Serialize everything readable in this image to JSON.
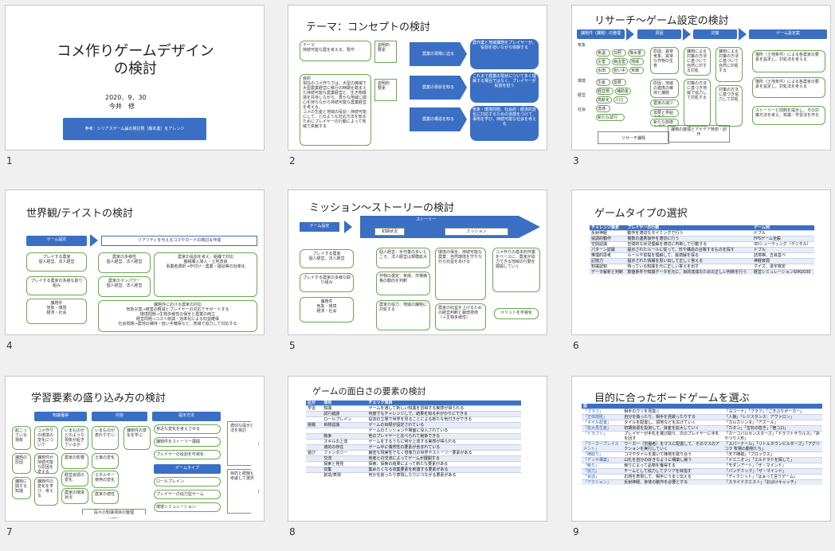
{
  "slide_numbers": [
    "1",
    "2",
    "3",
    "4",
    "5",
    "6",
    "7",
    "8",
    "9"
  ],
  "s1": {
    "title_line1": "コメ作りゲームデザイン",
    "title_line2": "の検討",
    "date": "2020．9．30",
    "author": "今井　修",
    "note": "参考：シリアスゲーム論の検討例（藤本進）をアレンジ"
  },
  "s2": {
    "title": "テーマ：コンセプトの検討",
    "box_theme": "テーマ\n持続可能な農を考える、豊作",
    "box_purpose": "目的\n現在のコメ作りでは、大型の機械で大型農業経営に移行の時期を踏まえた持続可能な農業経営と、生き物環境を共存しながら、豊かな地域に関心を持ちながら持続可能な農業経営を考える。\nコメの生産と地域の役割・持続可能にして、どのような対応方法を知るためにプレイヤーの行動によって地域で貢献する",
    "label_a": "説明的\n要素",
    "label_b": "説明的\n要素",
    "arrow1": "農業の現場に迫る",
    "arrow2": "農業の現状を知る",
    "arrow3": "農業の構造を知る",
    "res1": "農作業と地域課題をプレイヤーが、役割を担いながら体験する",
    "res2": "これまで農業の現状について多く理解する場合ではなく、プレイヤーが役割を担う",
    "res3": "気象・環境問題、社会的・経済的変化に対応するための道筋をつけて、事例を学び、持続可能な社会を考える"
  },
  "s3": {
    "title": "リサーチ〜ゲーム設定の検討",
    "hdr": [
      "課題件（課題）の整理",
      "原因",
      "対策",
      "ゲーム設定案"
    ],
    "left_labels": [
      "気象",
      "環境",
      "経営",
      "社会"
    ],
    "tags": [
      "気温",
      "日照",
      "降水量",
      "災害",
      "病虫害",
      "地域",
      "水田",
      "担い手",
      "米価",
      "生産",
      "需要",
      "経営規模",
      "補助金",
      "高齢化",
      "人口",
      "流通",
      "新たな試行"
    ],
    "cause": [
      "原因：異常気象、異常な作物の生育",
      "原因：地域の連携の維持と課題",
      "農家の減少",
      "需要と供給の変化",
      "新たな技術の課題"
    ],
    "measure": [
      "課題による対策の方法に基づいて自然に対する対処",
      "課題による対策の方法に基づいて自然に対処する",
      "対策の方法に基づき地域で協力して対処する",
      "対策の方法に基づき協力して対処"
    ],
    "game": [
      "場所（土地条件）による各農家の要素を設定し、対処法を考える",
      "場所（土地条件）による各農家の要素を設定し、対処法を考える",
      "ストーリーと問題を提示し、その対策方法を考え、知識・学習法を作る"
    ],
    "foot1": "リサーチ課題",
    "foot2": "課題の整理とアイデア発想・創作"
  },
  "s4": {
    "title": "世界観/テイストの検討",
    "hdr": "ゲーム設定",
    "banner": "リアリティを与えるコマやカードの検討＆作成",
    "left": [
      "プレイする農家\n個人経営、法人経営",
      "プレイする農家の多様な取り組み",
      "課題件\n気象・環境\n経済・社会"
    ],
    "mid": [
      "農家の多様性\n個人経営、法人経営",
      "農家のマンパワー\n個人経営、法人経営"
    ],
    "right": [
      "農家の役割を考え、組織で対応\n機械購入導入・土地改良\n事業者選択→作付け・農業・福祉等の効率化",
      "生産・共同作業・情報共有\n地域交流の強化",
      "農家の役割を考え、農業の展開と\n事業の継続・持続可能な地域づくり"
    ],
    "bottom": "課題件における農家の対応\n気象災害→被害の軽減とプレイヤーの対応でサポートする\n環境問題→生物多様性の保全と農業の両立\n経営問題→コスト削減・効率化による収益確保\n社会問題→農地の維持・担い手確保など、地域で協力して対応する"
  },
  "s5": {
    "title": "ミッション〜ストーリーの検討",
    "hdr": "ゲーム設定",
    "story": "ストーリー",
    "tab1": "初期状況",
    "tab2": "ミッション",
    "left": [
      "プレイする農家\n個人経営、法人経営",
      "プレイする農家の多様な取り組み",
      "課題件\n気象・環境\n経済・社会"
    ],
    "c1": [
      "個人経営：手作業の多いところ、法人経営は規模拡大",
      "作物の選定：気候、市場価格の動向を判断",
      "農家の協力：地域の課題に対処する"
    ],
    "c2": [
      "環境の保全、持続可能な農業：自然環境を守りながら収益をあげる",
      "農家の収益を上げるための経営判断と栽培技術（＋生物多様性）"
    ],
    "c3": [
      "コメ作りの基本的作業をベースに、農家が協力できる地域の行動を展開していく"
    ],
    "c4": "メリットを可視化"
  },
  "s6": {
    "title": "ゲームタイプの選択",
    "cols": [
      "チャレンジ要素",
      "プレイヤーの行動",
      "ゲーム例"
    ],
    "rows": [
      [
        "反射神経",
        "動作を適切なタイミングで行う",
        "ドブル"
      ],
      [
        "協調的動作",
        "複数の連携操作を適切に行う",
        "FPSゲーム全般"
      ],
      [
        "空間認識",
        "空間的な状況理解を適切に判断して行動する",
        "3Dシューティング（デジタル）"
      ],
      [
        "パターン認識",
        "提示されたルールに従って、形や構造の合致するものを探す",
        "ドブル"
      ],
      [
        "推理的思考",
        "ルールや前提を理解して、最適解を探る",
        "詰将棋、五目並べ"
      ],
      [
        "記憶力",
        "提示された情報を思い出して正しく答える",
        "神経衰弱"
      ],
      [
        "知識認知",
        "持っている知識を元に正しい答えを出す",
        "クイズ、漢字検定"
      ],
      [
        "データ解析と判断",
        "数値条件や知識データを元に、目的達成のための正しい判断を行う",
        "経営シミュレーションSIM2030"
      ]
    ]
  },
  "s7": {
    "title": "学習要素の盛り込み方の検討",
    "hdr": [
      "知識獲得",
      "内容",
      "提示方法"
    ],
    "c1": [
      "起こっている現象",
      "コメ作りの環境の変化について",
      "課題の原因",
      "課題に関する知識"
    ],
    "c2": [
      "課題件が持続可能な原因を変える",
      "課題件の変化を学び、考える",
      "課題件の変化を学ぶ"
    ],
    "c3": [
      "いまものがどのような現象が起きているか",
      "農家の影響",
      "経営資源の変化",
      "農家の環境状況"
    ],
    "c4": [
      "いまものが表れやすい",
      "土壌の変化",
      "エネルギー使用の変化",
      "農家の適性"
    ],
    "c5": [
      "身近な変化を考えさせる",
      "課題件をストーリー展開",
      "プレイヤーの役割を可視化"
    ],
    "gtype": "ゲームタイプ",
    "c5b": [
      "ロールプレイン",
      "プレイヤーの協力型ゲーム",
      "環境シミュレーション"
    ],
    "r1": "適切な提示方法を検討",
    "r2": "目的と経験を考慮して選択",
    "foot": "段々の知識項目の整理"
  },
  "s8": {
    "title": "ゲームの面白さの要素の検討",
    "cols": [
      "区分",
      "項目",
      "チェック項目"
    ],
    "rows": [
      [
        "学習",
        "知識",
        "ゲームを通して新しい知識を習得する実感が得られる"
      ],
      [
        "",
        "試行錯誤",
        "何度でもチャレンジして、結果を知る手がかりにできる"
      ],
      [
        "",
        "ロールプレイン",
        "役割の立場で世界を見ることによる新たな気付きができる"
      ],
      [
        "挑戦",
        "目標認識",
        "ゲームの目標が設定されている"
      ],
      [
        "",
        "",
        "ゲームのミッションや場面に没入されている"
      ],
      [
        "",
        "競争",
        "他のプレイヤーと比べられて競争できる"
      ],
      [
        "",
        "スキルの上達",
        "ゲームをするうちに何か上達する実感が得られる"
      ],
      [
        "",
        "運的の存在",
        "ゲーム中に偶然性の要素が含まれている"
      ],
      [
        "遊び",
        "ファンタジー",
        "厳密な現実性でなく想像力の世界やストーリー要素がある"
      ],
      [
        "",
        "交流",
        "他者との交流によってゲームが展開する"
      ],
      [
        "",
        "探索と発見",
        "探索、探索の結果によって新たな要素がある"
      ],
      [
        "",
        "収集",
        "集めたくなる収集要素を刺激する要素がある"
      ],
      [
        "",
        "創造/表現",
        "何かを創ったり表現したりにつながる要素がある"
      ]
    ]
  },
  "s9": {
    "title": "目的に合ったボードゲームを選ぶ",
    "cols": [
      "型",
      "",
      ""
    ],
    "rows": [
      [
        "「ブラフ」",
        "相手のウソを見抜く",
        "「ヨコーナ」「ブラフ」「ごきぶりポーカー」"
      ],
      [
        "「正体隠匿」",
        "自分を偽ったり、相手を見破ったりする",
        "「人狼」「レジスタンス：アヴァロン」"
      ],
      [
        "「タイル配置」",
        "タイルを配置し、領地などを広げていく",
        "「カルカソンヌ」「アズール」"
      ],
      [
        "「拡大再生産」",
        "初期資源を投資して、資産を拡大していく",
        "「カタン」「宝石の煌き」「宿コロ」"
      ],
      [
        "「ドラフト」",
        "プレイヤーが手札を選び取り、次のプレイヤーに手札を回す",
        "「カーコバルセンスターズ」「ドラフトサウルス」「あやつり人形」"
      ],
      [
        "「ワーカープレイスメント」",
        "ワーカー（労働者）をマスに配置して、そのマスのアクションを実行していく",
        "「スパーテール」「リトルタウンビルダーズ」「アグリコラ 牧場の動物たち」"
      ],
      [
        "「陣取り」",
        "コマやタイルを置いて陣地を取り合う",
        "「天下陣取」「ブロックス」"
      ],
      [
        "「デッキ構築」",
        "山札を自分の好きなように構築し競う",
        "「ドミニオン」「エルドラドを探して」"
      ],
      [
        "「競り」",
        "競りによって品物を獲得する",
        "「モダンアート」「ザ・マインド」"
      ],
      [
        "「協力」",
        "チームとして協力してクリアを目指す",
        "「パンデミック」「ザ・マインド」"
      ],
      [
        "「会話」",
        "お題を表現して、相手にうまく伝える",
        "「ディクシット」「はぁって言うゲーム」"
      ],
      [
        "「アクション」",
        "反射神経、身体の動作を必要とする",
        "「スライドクエスト」「おばけキャッチ」"
      ]
    ]
  }
}
